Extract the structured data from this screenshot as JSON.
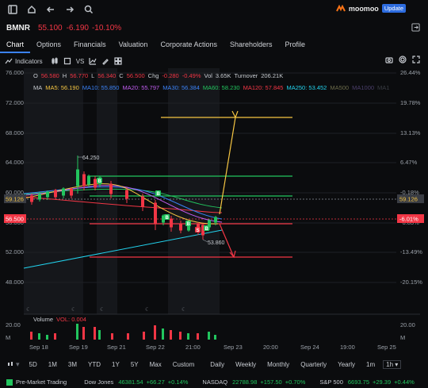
{
  "header": {
    "brand": "moomoo",
    "update_badge": "Update"
  },
  "ticker": {
    "symbol": "BMNR",
    "price": "55.100",
    "change": "-6.190",
    "change_pct": "-10.10%"
  },
  "tabs": [
    "Chart",
    "Options",
    "Financials",
    "Valuation",
    "Corporate Actions",
    "Shareholders",
    "Profile"
  ],
  "toolbar": {
    "indicators_label": "Indicators",
    "vs_label": "VS"
  },
  "ohlc": {
    "o_label": "O",
    "o": "56.580",
    "h_label": "H",
    "h": "56.770",
    "l_label": "L",
    "l": "56.340",
    "c_label": "C",
    "c": "56.500",
    "chg_label": "Chg",
    "chg": "-0.280",
    "chg_pct": "-0.49%",
    "vol_label": "Vol",
    "vol": "3.65K",
    "turnover_label": "Turnover",
    "turnover": "206.21K"
  },
  "ma_legend": {
    "title": "MA",
    "items": [
      {
        "label": "MA5: 56.190",
        "color": "#f5c542"
      },
      {
        "label": "MA10: 55.850",
        "color": "#3b82f6"
      },
      {
        "label": "MA20: 55.797",
        "color": "#c05cf0"
      },
      {
        "label": "MA30: 56.384",
        "color": "#3b82f6"
      },
      {
        "label": "MA60: 58.230",
        "color": "#22c55e"
      },
      {
        "label": "MA120: 57.845",
        "color": "#f23645"
      },
      {
        "label": "MA250: 53.452",
        "color": "#22d3ee"
      },
      {
        "label": "MA500",
        "color": "#6b6b4a"
      },
      {
        "label": "MA1000",
        "color": "#4b3f6b"
      },
      {
        "label": "MA1",
        "color": "#3a3d44"
      }
    ]
  },
  "y_axis_left": [
    "76.000",
    "72.000",
    "68.000",
    "64.000",
    "60.000",
    "56.000",
    "52.000",
    "48.000"
  ],
  "y_axis_right": [
    "26.44%",
    "19.78%",
    "13.13%",
    "6.47%",
    "-0.18%",
    "-6.83%",
    "-13.49%",
    "-20.15%"
  ],
  "price_tags": {
    "left_current": "59.126",
    "left_last": "56.500",
    "right_current": "59.126",
    "right_last": "-6.01%"
  },
  "annotations": {
    "high_label": "64.250",
    "low_label": "53.860",
    "m1": "B",
    "m2": "B",
    "m3": "B",
    "m4": "B",
    "m5": "S",
    "m6": "B"
  },
  "volume": {
    "label": "Volume",
    "vol_label": "VOL: 0.004",
    "axis_top": "20.00",
    "axis_bottom": "M",
    "axis_left_top": "20.00",
    "axis_left_bottom": "M"
  },
  "x_axis": [
    "Sep 18",
    "Sep 19",
    "Sep 21",
    "Sep 22",
    "21:00",
    "Sep 23",
    "20:00",
    "Sep 24",
    "19:00",
    "Sep 25"
  ],
  "timeframes": [
    "5D",
    "1M",
    "3M",
    "YTD",
    "1Y",
    "5Y",
    "Max",
    "Custom",
    "Daily",
    "Weekly",
    "Monthly",
    "Quarterly",
    "Yearly",
    "1m",
    "1h"
  ],
  "status": {
    "premarket": "Pre-Market Trading",
    "indices": [
      {
        "name": "Dow Jones",
        "value": "46381.54",
        "change": "+66.27",
        "pct": "+0.14%"
      },
      {
        "name": "NASDAQ",
        "value": "22788.98",
        "change": "+157.50",
        "pct": "+0.70%"
      },
      {
        "name": "S&P 500",
        "value": "6693.75",
        "change": "+29.39",
        "pct": "+0.44%"
      }
    ]
  },
  "colors": {
    "down": "#f23645",
    "up": "#22c55e",
    "accent": "#3b82f6",
    "projection": "#f5c542"
  }
}
